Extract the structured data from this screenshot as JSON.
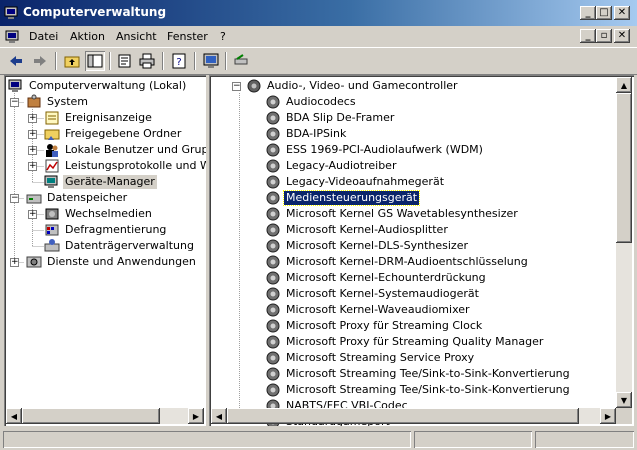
{
  "window": {
    "title": "Computerverwaltung"
  },
  "menu": {
    "items": [
      "Datei",
      "Aktion",
      "Ansicht",
      "Fenster",
      "?"
    ]
  },
  "tree": {
    "items": [
      {
        "label": "Computerverwaltung (Lokal)"
      },
      {
        "label": "System"
      },
      {
        "label": "Ereignisanzeige"
      },
      {
        "label": "Freigegebene Ordner"
      },
      {
        "label": "Lokale Benutzer und Gruppen"
      },
      {
        "label": "Leistungsprotokolle und Warnungen"
      },
      {
        "label": "Geräte-Manager"
      },
      {
        "label": "Datenspeicher"
      },
      {
        "label": "Wechselmedien"
      },
      {
        "label": "Defragmentierung"
      },
      {
        "label": "Datenträgerverwaltung"
      },
      {
        "label": "Dienste und Anwendungen"
      }
    ]
  },
  "devices": {
    "category": "Audio-, Video- und Gamecontroller",
    "selected": "Mediensteuerungsgerät",
    "items": [
      "Audiocodecs",
      "BDA Slip De-Framer",
      "BDA-IPSink",
      "ESS 1969-PCI-Audiolaufwerk (WDM)",
      "Legacy-Audiotreiber",
      "Legacy-Videoaufnahmegerät",
      "Mediensteuerungsgerät",
      "Microsoft Kernel GS Wavetablesynthesizer",
      "Microsoft Kernel-Audiosplitter",
      "Microsoft Kernel-DLS-Synthesizer",
      "Microsoft Kernel-DRM-Audioentschlüsselung",
      "Microsoft Kernel-Echounterdrückung",
      "Microsoft Kernel-Systemaudiogerät",
      "Microsoft Kernel-Waveaudiomixer",
      "Microsoft Proxy für Streaming Clock",
      "Microsoft Proxy für Streaming Quality Manager",
      "Microsoft Streaming Service Proxy",
      "Microsoft Streaming Tee/Sink-to-Sink-Konvertierung",
      "Microsoft Streaming Tee/Sink-to-Sink-Konvertierung",
      "NABTS/FEC VBI-Codec",
      "Standardgameport"
    ]
  },
  "colors": {
    "titlebar_start": "#0a246a",
    "titlebar_end": "#a6caf0",
    "selection": "#0a246a",
    "face": "#d4d0c8"
  },
  "icons": {
    "toolbar": [
      "back-arrow-icon",
      "forward-arrow-icon",
      "up-folder-icon",
      "show-tree-icon",
      "properties-icon",
      "print-icon",
      "help-icon",
      "computer-monitor-icon",
      "scan-hardware-icon"
    ]
  }
}
